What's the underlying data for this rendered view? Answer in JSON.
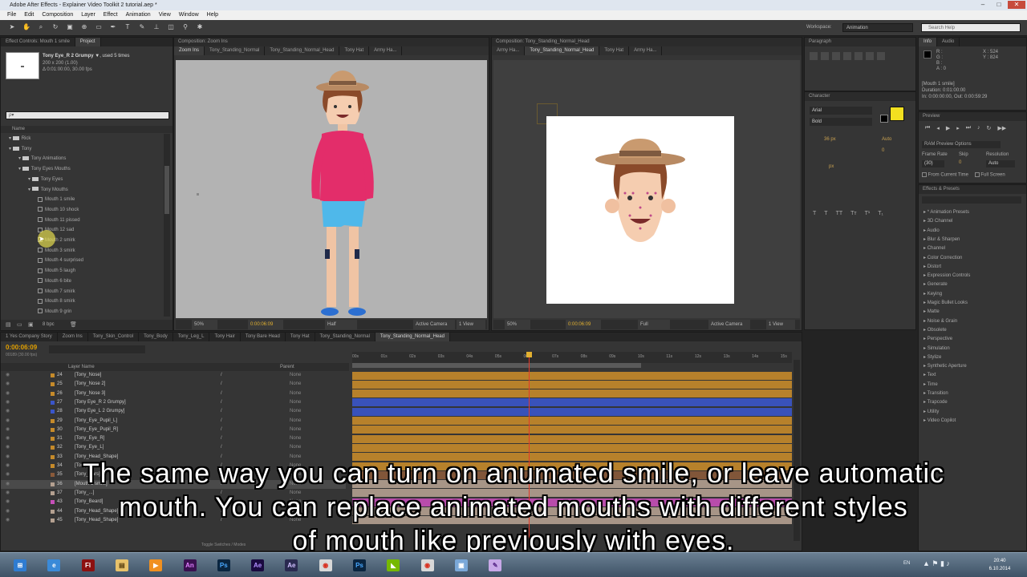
{
  "window": {
    "title": "Adobe After Effects - Explainer Video Toolkit 2 tutorial.aep *",
    "minimize": "–",
    "maximize": "□",
    "close": "✕"
  },
  "menu": [
    "File",
    "Edit",
    "Composition",
    "Layer",
    "Effect",
    "Animation",
    "View",
    "Window",
    "Help"
  ],
  "toolbar": {
    "workspace_label": "Workspace:",
    "workspace_value": "Animation",
    "search_placeholder": "Search Help"
  },
  "project_panel": {
    "tabs": [
      "Effect Controls: Mouth 1 smile",
      "Project"
    ],
    "selected_item": "Tony Eye_R 2 Grumpy ▼",
    "selected_used": ", used 5 times",
    "selected_size": "200 x 200 (1.00)",
    "selected_duration": "Δ 0:01:00:00, 30.00 fps",
    "search_placeholder": "ρ▾",
    "column_name": "Name",
    "tree": [
      {
        "label": "Rick",
        "indent": 0,
        "type": "folder"
      },
      {
        "label": "Tony",
        "indent": 0,
        "type": "folder"
      },
      {
        "label": "Tony Animations",
        "indent": 1,
        "type": "folder"
      },
      {
        "label": "Tony Eyes Mouths",
        "indent": 1,
        "type": "folder"
      },
      {
        "label": "Tony Eyes",
        "indent": 2,
        "type": "folder"
      },
      {
        "label": "Tony Mouths",
        "indent": 2,
        "type": "folder"
      },
      {
        "label": "Mouth 1 smile",
        "indent": 3,
        "type": "comp"
      },
      {
        "label": "Mouth 10 shock",
        "indent": 3,
        "type": "comp"
      },
      {
        "label": "Mouth 11 pissed",
        "indent": 3,
        "type": "comp"
      },
      {
        "label": "Mouth 12 sad",
        "indent": 3,
        "type": "comp"
      },
      {
        "label": "Mouth 2 smirk",
        "indent": 3,
        "type": "comp"
      },
      {
        "label": "Mouth 3 smirk",
        "indent": 3,
        "type": "comp"
      },
      {
        "label": "Mouth 4 surprised",
        "indent": 3,
        "type": "comp"
      },
      {
        "label": "Mouth 5 laugh",
        "indent": 3,
        "type": "comp"
      },
      {
        "label": "Mouth 6 bite",
        "indent": 3,
        "type": "comp"
      },
      {
        "label": "Mouth 7 smirk",
        "indent": 3,
        "type": "comp"
      },
      {
        "label": "Mouth 8 smirk",
        "indent": 3,
        "type": "comp"
      },
      {
        "label": "Mouth 9 grin",
        "indent": 3,
        "type": "comp"
      }
    ],
    "bpc": "8 bpc"
  },
  "comp_left": {
    "title": "Composition: Zoom Ins",
    "tabs": [
      "Zoom Ins",
      "Tony_Standing_Normal",
      "Tony_Standing_Normal_Head",
      "Tony Hat",
      "Army Ha..."
    ],
    "zoom": "50%",
    "timecode": "0:00:06:09",
    "resolution": "Half",
    "camera": "Active Camera",
    "view": "1 View"
  },
  "comp_right": {
    "title": "Composition: Tony_Standing_Normal_Head",
    "tabs": [
      "Army Ha...",
      "Tony_Standing_Normal_Head",
      "Tony Hat",
      "Army Ha..."
    ],
    "zoom": "50%",
    "timecode": "0:00:06:09",
    "resolution": "Full",
    "camera": "Active Camera",
    "view": "1 View"
  },
  "right_panels": {
    "paragraph_tab": "Paragraph",
    "info_tab": "Info",
    "audio_tab": "Audio",
    "info_r": "R :",
    "info_g": "G :",
    "info_b": "B :",
    "info_a": "A : 0",
    "info_x": "X : 524",
    "info_y": "Y : 824",
    "info_layer": "[Mouth 1 smile]",
    "info_duration": "Duration: 0:01:00:00",
    "info_inout": "In: 0:00:00:00, Out: 0:00:59:29",
    "character_tab": "Character",
    "font_value": "Arial",
    "style_value": "Bold",
    "font_size": "36 px",
    "leading": "Auto",
    "tracking": "0",
    "stroke": "px",
    "preview_tab": "Preview",
    "ram_preview": "RAM Preview Options",
    "frame_rate_label": "Frame Rate",
    "skip_label": "Skip",
    "resolution_label": "Resolution",
    "frame_rate": "(30)",
    "skip": "0",
    "resolution": "Auto",
    "from_current": "From Current Time",
    "full_screen": "Full Screen",
    "effects_tab": "Effects & Presets",
    "effects": [
      "* Animation Presets",
      "3D Channel",
      "Audio",
      "Blur & Sharpen",
      "Channel",
      "Color Correction",
      "Distort",
      "Expression Controls",
      "Generate",
      "Keying",
      "Magic Bullet Looks",
      "Matte",
      "Noise & Grain",
      "Obsolete",
      "Perspective",
      "Simulation",
      "Stylize",
      "Synthetic Aperture",
      "Text",
      "Time",
      "Transition",
      "Trapcode",
      "Utility",
      "Video Copilot"
    ]
  },
  "timeline": {
    "tabs": [
      "1 Yes Company Story",
      "Zoom Ins",
      "Tony_Skin_Control",
      "Tony_Body",
      "Tony_Leg_L",
      "Tony Hair",
      "Tony Bare Head",
      "Tony Hat",
      "Tony_Standing_Normal",
      "Tony_Standing_Normal_Head"
    ],
    "timecode": "0:00:06:09",
    "fps_note": "00189 (30.00 fps)",
    "col_layer_name": "Layer Name",
    "col_parent": "Parent",
    "ruler": [
      "00s",
      "01s",
      "02s",
      "03s",
      "04s",
      "05s",
      "06s",
      "07s",
      "08s",
      "09s",
      "10s",
      "11s",
      "12s",
      "13s",
      "14s",
      "15s"
    ],
    "layers": [
      {
        "num": "24",
        "name": "[Tony_Nose]",
        "parent": "None",
        "color": "#c58a2a"
      },
      {
        "num": "25",
        "name": "[Tony_Nose 2]",
        "parent": "None",
        "color": "#c58a2a"
      },
      {
        "num": "26",
        "name": "[Tony_Nose 3]",
        "parent": "None",
        "color": "#c58a2a"
      },
      {
        "num": "27",
        "name": "[Tony Eye_R 2 Grumpy]",
        "parent": "None",
        "color": "#3a55c9"
      },
      {
        "num": "28",
        "name": "[Tony Eye_L 2 Grumpy]",
        "parent": "None",
        "color": "#3a55c9"
      },
      {
        "num": "29",
        "name": "[Tony_Eye_Pupil_L]",
        "parent": "None",
        "color": "#c58a2a"
      },
      {
        "num": "30",
        "name": "[Tony_Eye_Pupil_R]",
        "parent": "None",
        "color": "#c58a2a"
      },
      {
        "num": "31",
        "name": "[Tony_Eye_R]",
        "parent": "None",
        "color": "#c58a2a"
      },
      {
        "num": "32",
        "name": "[Tony_Eye_L]",
        "parent": "None",
        "color": "#c58a2a"
      },
      {
        "num": "33",
        "name": "[Tony_Head_Shape]",
        "parent": "None",
        "color": "#c58a2a"
      },
      {
        "num": "34",
        "name": "[Tony_...]",
        "parent": "None",
        "color": "#c58a2a"
      },
      {
        "num": "35",
        "name": "[Tony_Ears]",
        "parent": "None",
        "color": "#8a5a3a"
      },
      {
        "num": "36",
        "name": "[Mouth 1 smile]",
        "parent": "None",
        "color": "#b4a090"
      },
      {
        "num": "37",
        "name": "[Tony_...]",
        "parent": "None",
        "color": "#b4a090"
      },
      {
        "num": "43",
        "name": "[Tony_Beard]",
        "parent": "None",
        "color": "#c64fb8"
      },
      {
        "num": "44",
        "name": "[Tony_Head_Shape]",
        "parent": "None",
        "color": "#b4a090"
      },
      {
        "num": "45",
        "name": "[Tony_Head_Shape]",
        "parent": "None",
        "color": "#b4a090"
      }
    ],
    "toggle_label": "Toggle Switches / Modes"
  },
  "subtitles": [
    "The same way you can turn on anumated smile, or leave automatic",
    "mouth. You can replace animated mouths with different styles",
    "of mouth like previously with eyes."
  ],
  "taskbar": {
    "apps": [
      {
        "name": "start",
        "glyph": "⊞",
        "bg": "#2f7cd1",
        "fg": "#ffffff"
      },
      {
        "name": "ie",
        "glyph": "e",
        "bg": "#3a8ad8",
        "fg": "#ffffff"
      },
      {
        "name": "flash",
        "glyph": "Fl",
        "bg": "#8c1010",
        "fg": "#ffffff"
      },
      {
        "name": "explorer",
        "glyph": "▤",
        "bg": "#e8c26a",
        "fg": "#5a4010"
      },
      {
        "name": "media",
        "glyph": "▶",
        "bg": "#f09020",
        "fg": "#ffffff"
      },
      {
        "name": "animate",
        "glyph": "An",
        "bg": "#3a1050",
        "fg": "#e080ff"
      },
      {
        "name": "photoshop",
        "glyph": "Ps",
        "bg": "#0a2540",
        "fg": "#48a8ff"
      },
      {
        "name": "aftereffects",
        "glyph": "Ae",
        "bg": "#1a0a40",
        "fg": "#b090ff"
      },
      {
        "name": "mediaencoder",
        "glyph": "Ae",
        "bg": "#2a2a50",
        "fg": "#d0c0ff"
      },
      {
        "name": "chrome",
        "glyph": "◉",
        "bg": "#d8d8d8",
        "fg": "#d83020"
      },
      {
        "name": "photoshop2",
        "glyph": "Ps",
        "bg": "#0a2540",
        "fg": "#48a8ff"
      },
      {
        "name": "nvidia",
        "glyph": "◣",
        "bg": "#76b900",
        "fg": "#ffffff"
      },
      {
        "name": "chrome2",
        "glyph": "◉",
        "bg": "#d8d8d8",
        "fg": "#d83020"
      },
      {
        "name": "tool",
        "glyph": "▣",
        "bg": "#7aa8d8",
        "fg": "#ffffff"
      },
      {
        "name": "paint",
        "glyph": "✎",
        "bg": "#c8a8e8",
        "fg": "#5a2a8a"
      }
    ],
    "lang": "EN",
    "time": "20:40",
    "date": "6.10.2014"
  }
}
